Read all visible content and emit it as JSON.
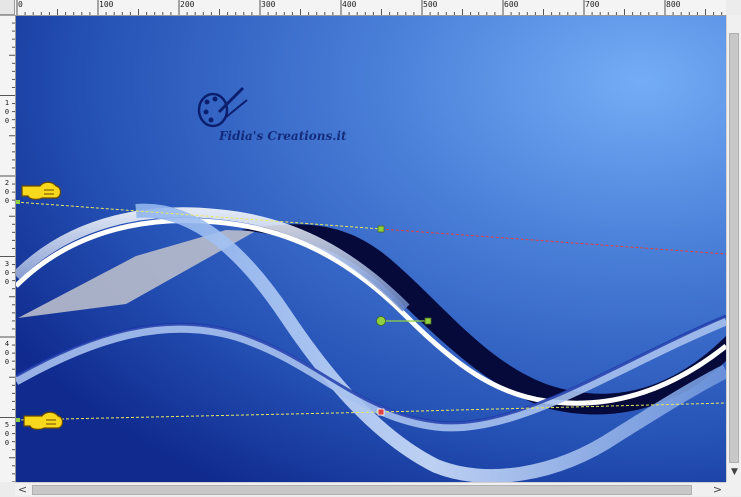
{
  "rulers": {
    "top_labels": [
      "0",
      "100",
      "200",
      "300",
      "400",
      "500",
      "600",
      "700",
      "800"
    ],
    "left_labels": [
      [
        "1",
        "0",
        "0"
      ],
      [
        "2",
        "0",
        "0"
      ],
      [
        "3",
        "0",
        "0"
      ],
      [
        "4",
        "0",
        "0"
      ],
      [
        "5",
        "0",
        "0"
      ]
    ]
  },
  "watermark": {
    "text": "Fidia's Creations.it"
  },
  "colors": {
    "canvas_dark": "#0d2a8c",
    "canvas_light": "#6fa8f2",
    "guide_yellow": "#e8e860",
    "guide_red": "#e04040",
    "node_green": "#90d040"
  },
  "icons": {
    "guide_pointer_top": "pointing-hand-icon",
    "guide_pointer_bottom": "pointing-hand-icon",
    "scroll_left": "arrow-left-icon",
    "scroll_right": "arrow-right-icon",
    "scroll_down": "arrow-down-icon"
  }
}
